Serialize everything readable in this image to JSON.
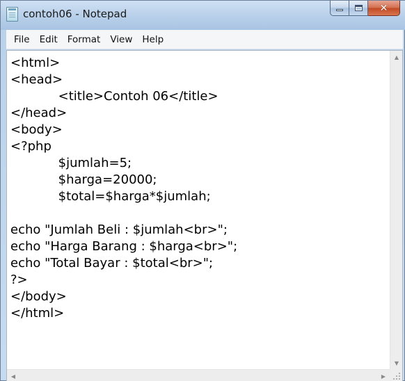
{
  "window": {
    "title": "contoh06 - Notepad",
    "controls": {
      "minimize": "–",
      "maximize": "□",
      "close": "✕"
    }
  },
  "menu": {
    "items": [
      {
        "label": "File"
      },
      {
        "label": "Edit"
      },
      {
        "label": "Format"
      },
      {
        "label": "View"
      },
      {
        "label": "Help"
      }
    ]
  },
  "editor": {
    "lines": [
      "<html>",
      "<head>",
      "            <title>Contoh 06</title>",
      "</head>",
      "<body>",
      "<?php",
      "            $jumlah=5;",
      "            $harga=20000;",
      "            $total=$harga*$jumlah;",
      "",
      "echo \"Jumlah Beli : $jumlah<br>\";",
      "echo \"Harga Barang : $harga<br>\";",
      "echo \"Total Bayar : $total<br>\";",
      "?>",
      "</body>",
      "</html>"
    ]
  },
  "scrollbars": {
    "up_arrow": "▲",
    "down_arrow": "▼",
    "left_arrow": "◀",
    "right_arrow": "▶"
  },
  "icons": {
    "app": "notepad-icon"
  }
}
